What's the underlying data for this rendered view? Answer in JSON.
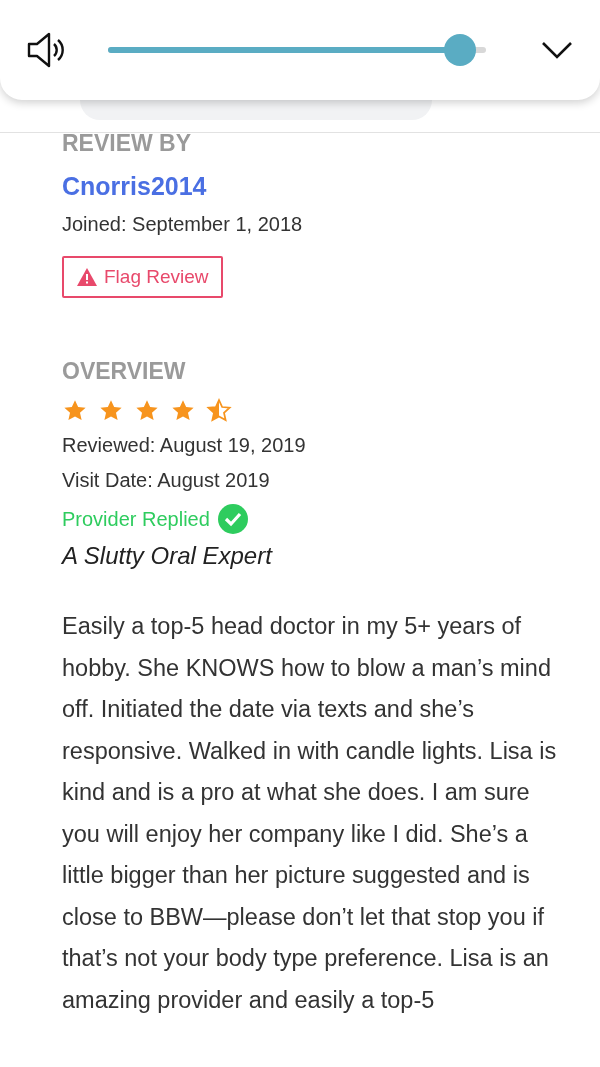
{
  "volume_panel": {
    "level": 0.93
  },
  "reviewer": {
    "heading": "REVIEW BY",
    "name": "Cnorris2014",
    "joined": "Joined: September 1, 2018",
    "flag_button": "Flag Review"
  },
  "overview": {
    "heading": "OVERVIEW",
    "stars": 4.5,
    "reviewed": "Reviewed: August 19, 2019",
    "visit_date": "Visit Date: August 2019",
    "provider_replied": "Provider Replied",
    "title": "A Slutty Oral Expert"
  },
  "body": "Easily a top-5 head doctor in my 5+ years of hobby. She KNOWS how to blow a man’s mind off. Initiated the date via texts and she’s responsive. Walked in with candle lights. Lisa is kind and is a pro at what she does.  I am sure you will enjoy her company like I did.  She’s a little bigger than her picture suggested and is close to BBW—please don’t let that stop you if that’s not your body type preference. Lisa is an amazing provider and easily a top-5"
}
